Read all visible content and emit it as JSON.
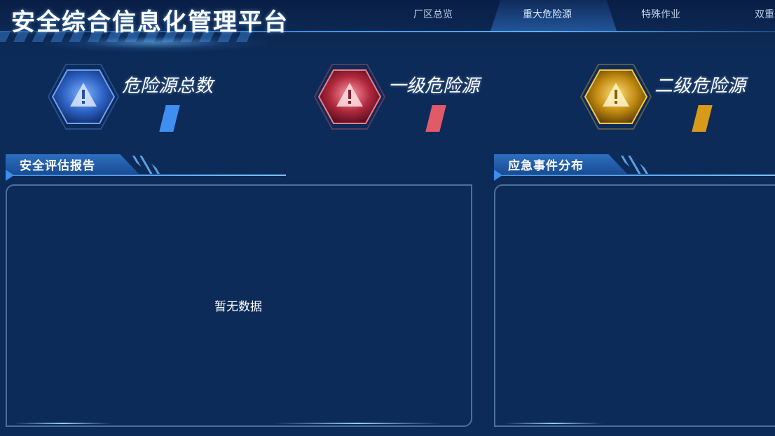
{
  "app": {
    "title": "安全综合信息化管理平台"
  },
  "nav": {
    "items": [
      {
        "label": "厂区总览",
        "active": false
      },
      {
        "label": "重大危险源",
        "active": true
      },
      {
        "label": "特殊作业",
        "active": false
      },
      {
        "label": "双重",
        "active": false
      }
    ]
  },
  "stats": [
    {
      "label": "危险源总数",
      "value": "",
      "color": "#3f8ff0",
      "icon": "warning-icon"
    },
    {
      "label": "一级危险源",
      "value": "",
      "color": "#e05a6a",
      "icon": "warning-icon"
    },
    {
      "label": "二级危险源",
      "value": "",
      "color": "#d89a1a",
      "icon": "warning-icon"
    }
  ],
  "panels": {
    "assessment": {
      "title": "安全评估报告",
      "empty_text": "暂无数据"
    },
    "incidents": {
      "title": "应急事件分布"
    }
  },
  "colors": {
    "background": "#0c2b58",
    "accent": "#3d8ee8",
    "level1": "#e05a6a",
    "level2": "#d89a1a"
  }
}
